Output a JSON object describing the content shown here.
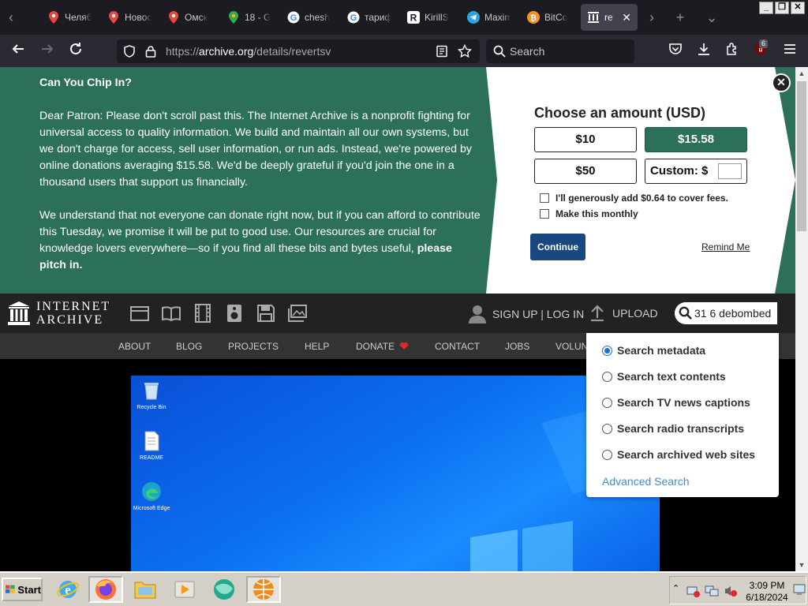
{
  "browser": {
    "tabs": [
      {
        "title": "Челяб",
        "icon": "map-pin-icon",
        "color": "#e8453c"
      },
      {
        "title": "Новос",
        "icon": "map-pin-icon",
        "color": "#e8453c"
      },
      {
        "title": "Омск",
        "icon": "map-pin-icon",
        "color": "#e8453c"
      },
      {
        "title": "18 - G",
        "icon": "google-maps-icon",
        "color": "#34a853"
      },
      {
        "title": "chesh",
        "icon": "google-icon",
        "color": "#4285f4"
      },
      {
        "title": "тариф",
        "icon": "google-icon",
        "color": "#4285f4"
      },
      {
        "title": "KirillS",
        "icon": "r-logo-icon",
        "color": "#ffffff"
      },
      {
        "title": "Maxim",
        "icon": "telegram-icon",
        "color": "#2aa3e0"
      },
      {
        "title": "BitCo",
        "icon": "bitcoin-icon",
        "color": "#f7931a"
      },
      {
        "title": "reve",
        "icon": "archive-icon",
        "color": "#ffffff",
        "active": true
      }
    ],
    "url_scheme": "https://",
    "url_host": "archive.org",
    "url_path": "/details/revertsv",
    "search_placeholder": "Search",
    "extension_badge": "6"
  },
  "banner": {
    "heading": "Can You Chip In?",
    "paragraph1": "Dear Patron: Please don't scroll past this. The Internet Archive is a nonprofit fighting for universal access to quality information. We build and maintain all our own systems, but we don't charge for access, sell user information, or run ads. Instead, we're powered by online donations averaging $15.58. We'd be deeply grateful if you'd join the one in a thousand users that support us financially.",
    "paragraph2_start": "We understand that not everyone can donate right now, but if you can afford to contribute this Tuesday, we promise it will be put to good use. Our resources are crucial for knowledge lovers everywhere—so if you find all these bits and bytes useful, ",
    "paragraph2_bold": "please pitch in.",
    "amount_title": "Choose an amount (USD)",
    "amount_10": "$10",
    "amount_15": "$15.58",
    "amount_50": "$50",
    "custom_label": "Custom: $",
    "fee_label": "I'll generously add $0.64 to cover fees.",
    "monthly_label": "Make this monthly",
    "continue_label": "Continue",
    "remind_label": "Remind Me",
    "close_glyph": "✕"
  },
  "ia_header": {
    "logo_line1": "INTERNET",
    "logo_line2": "ARCHIVE",
    "signup_label": "SIGN UP | LOG IN",
    "upload_label": "UPLOAD",
    "search_value": "31 6 debombed"
  },
  "subnav": {
    "about": "ABOUT",
    "blog": "BLOG",
    "projects": "PROJECTS",
    "help": "HELP",
    "donate": "DONATE",
    "contact": "CONTACT",
    "jobs": "JOBS",
    "volunteer": "VOLUN"
  },
  "search_options": {
    "metadata": "Search metadata",
    "text": "Search text contents",
    "tv": "Search TV news captions",
    "radio": "Search radio transcripts",
    "web": "Search archived web sites",
    "advanced": "Advanced Search"
  },
  "desktop_icons": {
    "recycle": "Recycle Bin",
    "readme": "README",
    "edge": "Microsoft Edge"
  },
  "taskbar": {
    "start_label": "Start",
    "clock_time": "3:09 PM",
    "clock_date": "6/18/2024"
  }
}
